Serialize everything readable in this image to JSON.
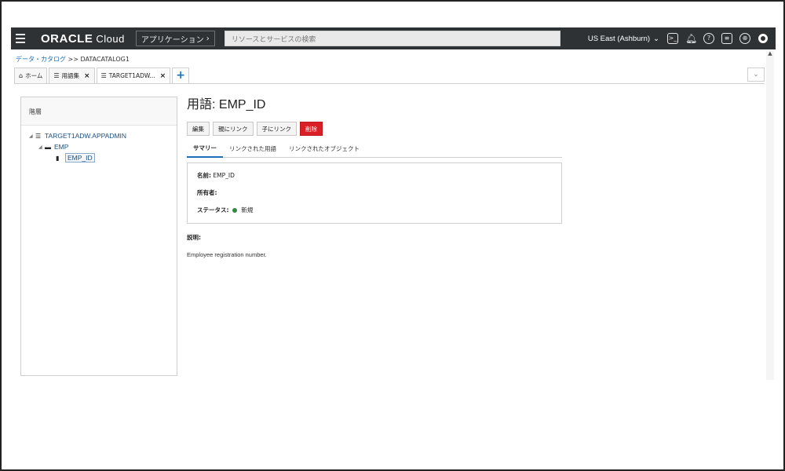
{
  "topbar": {
    "brand": "ORACLE",
    "brand_sub": "Cloud",
    "apps_label": "アプリケーション",
    "search_placeholder": "リソースとサービスの検索",
    "region": "US East (Ashburn)"
  },
  "breadcrumb": {
    "root": "データ・カタログ",
    "separator": ">>",
    "current": "DATACATALOG1"
  },
  "tabs": [
    {
      "label": "ホーム"
    },
    {
      "label": "用語集"
    },
    {
      "label": "TARGET1ADW..."
    }
  ],
  "hierarchy": {
    "title": "階層",
    "nodes": [
      {
        "label": "TARGET1ADW.APPADMIN"
      },
      {
        "label": "EMP"
      },
      {
        "label": "EMP_ID"
      }
    ]
  },
  "term": {
    "title": "用語: EMP_ID",
    "actions": {
      "edit": "編集",
      "link_parent": "親にリンク",
      "link_child": "子にリンク",
      "delete": "削除"
    },
    "subtabs": [
      "サマリー",
      "リンクされた用語",
      "リンクされたオブジェクト"
    ],
    "summary": {
      "name_label": "名前:",
      "name_value": "EMP_ID",
      "owner_label": "所有者:",
      "status_label": "ステータス:",
      "status_value": "新規"
    },
    "description_label": "説明:",
    "description": "Employee registration number."
  },
  "colors": {
    "topbar": "#2f3235",
    "accent": "#1d6fb8",
    "danger": "#d81f26",
    "status_new": "#2e8b3e"
  }
}
